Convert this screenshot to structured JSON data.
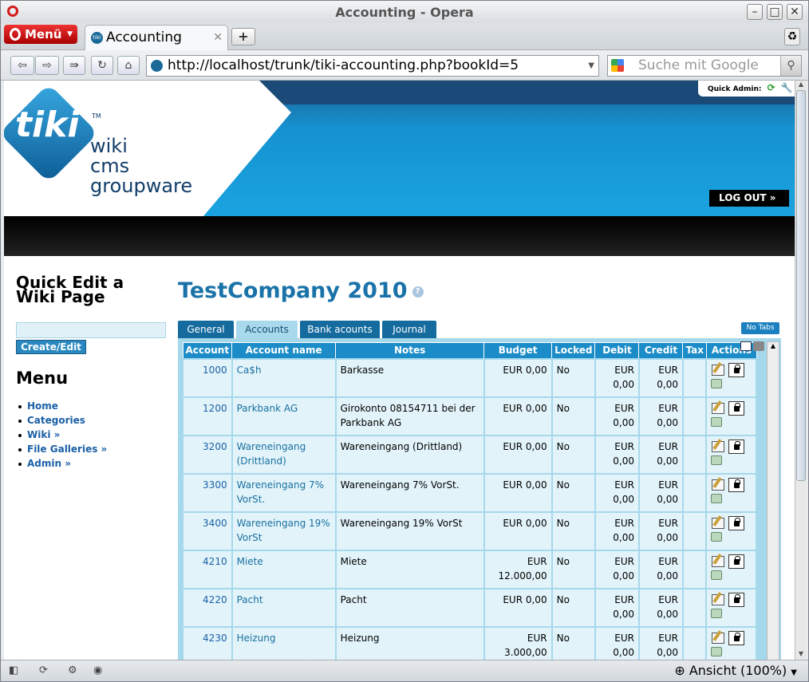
{
  "window": {
    "title": "Accounting - Opera"
  },
  "browser": {
    "menu_label": "Menü",
    "tab_title": "Accounting",
    "tab_favicon_text": "tiki",
    "url": "http://localhost/trunk/tiki-accounting.php?bookId=5",
    "search_placeholder": "Suche mit Google",
    "zoom": "Ansicht (100%)"
  },
  "header": {
    "logo_text": "tiki",
    "logo_tm": "TM",
    "logo_words": [
      "wiki",
      "cms",
      "groupware"
    ],
    "quick_admin": "Quick Admin:",
    "logout": "LOG OUT »"
  },
  "sidebar": {
    "quick_edit_title": "Quick Edit a Wiki Page",
    "create_button": "Create/Edit",
    "menu_title": "Menu",
    "items": [
      {
        "label": "Home"
      },
      {
        "label": "Categories"
      },
      {
        "label": "Wiki »"
      },
      {
        "label": "File Galleries »"
      },
      {
        "label": "Admin »"
      }
    ]
  },
  "main": {
    "title": "TestCompany 2010",
    "tabs": [
      {
        "label": "General"
      },
      {
        "label": "Accounts"
      },
      {
        "label": "Bank acounts"
      },
      {
        "label": "Journal"
      }
    ],
    "no_tabs": "No Tabs",
    "columns": [
      "Account",
      "Account name",
      "Notes",
      "Budget",
      "Locked",
      "Debit",
      "Credit",
      "Tax",
      "Actions"
    ],
    "rows": [
      {
        "account": "1000",
        "name": "Ca$h",
        "notes": "Barkasse",
        "budget": "EUR 0,00",
        "locked": "No",
        "debit": "EUR 0,00",
        "credit": "EUR 0,00",
        "tax": ""
      },
      {
        "account": "1200",
        "name": "Parkbank AG",
        "notes": "Girokonto 08154711 bei der Parkbank AG",
        "budget": "EUR 0,00",
        "locked": "No",
        "debit": "EUR 0,00",
        "credit": "EUR 0,00",
        "tax": ""
      },
      {
        "account": "3200",
        "name": "Wareneingang (Drittland)",
        "notes": "Wareneingang (Drittland)",
        "budget": "EUR 0,00",
        "locked": "No",
        "debit": "EUR 0,00",
        "credit": "EUR 0,00",
        "tax": ""
      },
      {
        "account": "3300",
        "name": "Wareneingang 7% VorSt.",
        "notes": "Wareneingang 7% VorSt.",
        "budget": "EUR 0,00",
        "locked": "No",
        "debit": "EUR 0,00",
        "credit": "EUR 0,00",
        "tax": ""
      },
      {
        "account": "3400",
        "name": "Wareneingang 19% VorSt",
        "notes": "Wareneingang 19% VorSt",
        "budget": "EUR 0,00",
        "locked": "No",
        "debit": "EUR 0,00",
        "credit": "EUR 0,00",
        "tax": ""
      },
      {
        "account": "4210",
        "name": "Miete",
        "notes": "Miete",
        "budget": "EUR 12.000,00",
        "locked": "No",
        "debit": "EUR 0,00",
        "credit": "EUR 0,00",
        "tax": ""
      },
      {
        "account": "4220",
        "name": "Pacht",
        "notes": "Pacht",
        "budget": "EUR 0,00",
        "locked": "No",
        "debit": "EUR 0,00",
        "credit": "EUR 0,00",
        "tax": ""
      },
      {
        "account": "4230",
        "name": "Heizung",
        "notes": "Heizung",
        "budget": "EUR 3.000,00",
        "locked": "No",
        "debit": "EUR 0,00",
        "credit": "EUR 0,00",
        "tax": ""
      }
    ]
  },
  "colors": {
    "accent": "#1b8cc7",
    "title": "#1a73a8",
    "row_bg": "#e2f4fa"
  }
}
